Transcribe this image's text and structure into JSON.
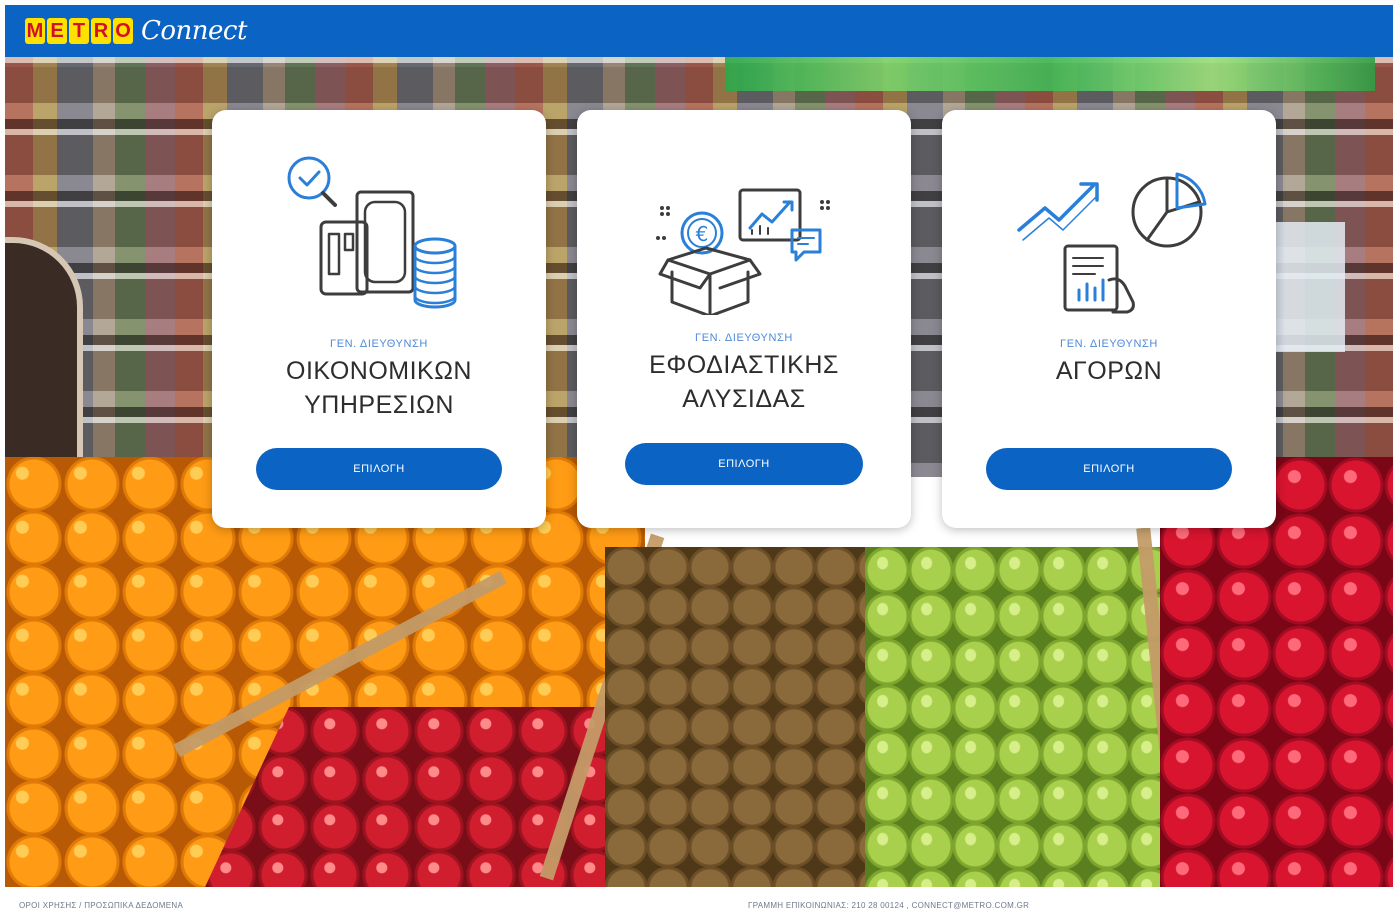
{
  "header": {
    "logo_metro_letters": [
      "M",
      "E",
      "T",
      "R",
      "O"
    ],
    "logo_connect": "Connect",
    "background_color": "#0b63c3"
  },
  "cards": [
    {
      "icon": "finance-icon",
      "subtitle": "ΓΕΝ. ΔΙΕΥΘΥΝΣΗ",
      "title": "ΟΙΚΟΝΟΜΙΚΩΝ\nΥΠΗΡΕΣΙΩΝ",
      "button_label": "ΕΠΙΛΟΓΗ"
    },
    {
      "icon": "supply-chain-icon",
      "subtitle": "ΓΕΝ. ΔΙΕΥΘΥΝΣΗ",
      "title": "ΕΦΟΔΙΑΣΤΙΚΗΣ\nΑΛΥΣΙΔΑΣ",
      "button_label": "ΕΠΙΛΟΓΗ"
    },
    {
      "icon": "purchasing-analytics-icon",
      "subtitle": "ΓΕΝ. ΔΙΕΥΘΥΝΣΗ",
      "title": "ΑΓΟΡΩΝ",
      "button_label": "ΕΠΙΛΟΓΗ"
    }
  ],
  "footer": {
    "left_text": "ΟΡΟΙ ΧΡΗΣΗΣ / ΠΡΟΣΩΠΙΚΑ ΔΕΔΟΜΕΝΑ",
    "right_text": "ΓΡΑΜΜΗ ΕΠΙΚΟΙΝΩΝΙΑΣ: 210 28 00124 , CONNECT@METRO.COM.GR"
  },
  "colors": {
    "primary_blue": "#0b63c3",
    "icon_blue": "#2a7fd8",
    "icon_gray": "#3d3d3d"
  }
}
